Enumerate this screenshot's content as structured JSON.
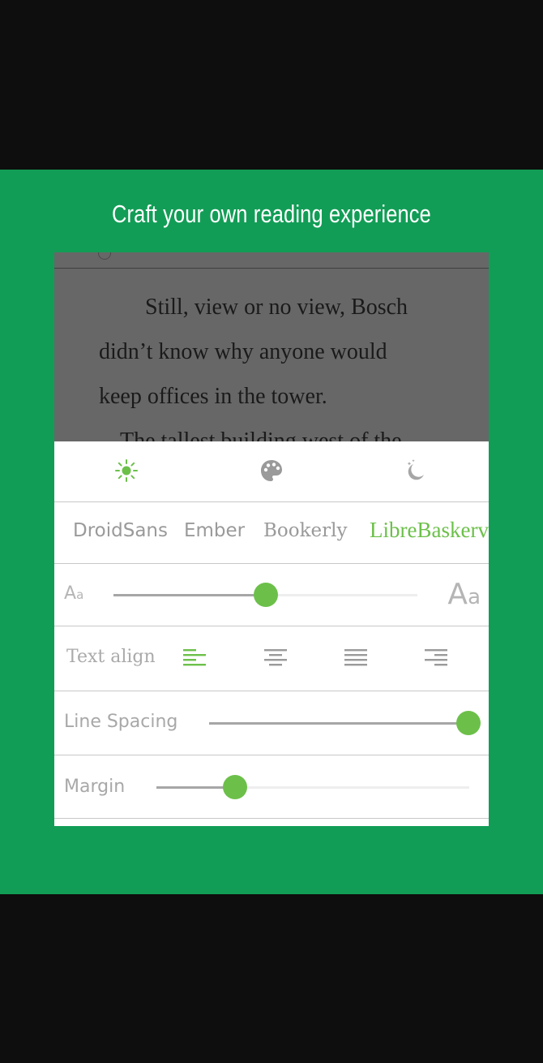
{
  "headline": "Craft your own reading experience",
  "reader": {
    "line1": "Still, view or no view, Bosch",
    "line2": "didn’t know why anyone would",
    "line3": "keep offices in the tower.",
    "line4": "The tallest building west of the"
  },
  "themes": {
    "items": [
      {
        "icon": "sun-icon",
        "active": true
      },
      {
        "icon": "palette-icon",
        "active": false
      },
      {
        "icon": "night-mode-icon",
        "active": false
      }
    ]
  },
  "fonts": {
    "options": [
      "DroidSans",
      "Ember",
      "Bookerly",
      "LibreBaskerville"
    ],
    "selected": "LibreBaskerville"
  },
  "font_size": {
    "small_glyph": "A",
    "small_glyph_sub": "a",
    "large_glyph": "A",
    "large_glyph_sub": "a",
    "level": 0.5
  },
  "text_align": {
    "label": "Text align",
    "options": [
      "left",
      "center",
      "justify",
      "right"
    ],
    "selected": "left"
  },
  "line_spacing": {
    "label": "Line Spacing",
    "level": 1.0
  },
  "margin": {
    "label": "Margin",
    "level": 0.25
  },
  "colors": {
    "banner": "#129d56",
    "accent": "#6cc04a",
    "inactive": "#a6a6a6",
    "reader_bg": "#676767"
  }
}
